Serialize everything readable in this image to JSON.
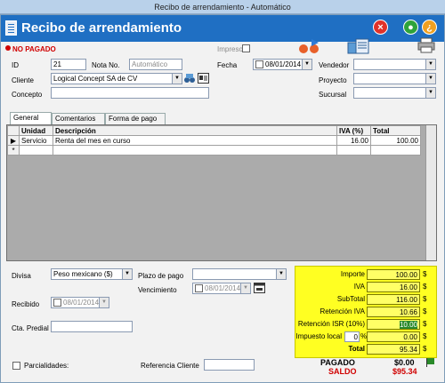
{
  "window": {
    "title": "Recibo de arrendamiento - Automático"
  },
  "header": {
    "title": "Recibo de arrendamiento"
  },
  "status": {
    "label": "NO PAGADO",
    "color": "#d00000"
  },
  "impreso": {
    "label": "Impreso"
  },
  "fields": {
    "id": {
      "label": "ID",
      "value": "21"
    },
    "nota": {
      "label": "Nota No.",
      "value": "Automático"
    },
    "fecha": {
      "label": "Fecha",
      "value": "08/01/2014"
    },
    "cliente": {
      "label": "Cliente",
      "value": "Logical Concept SA de CV"
    },
    "concepto": {
      "label": "Concepto",
      "value": ""
    },
    "vendedor": {
      "label": "Vendedor",
      "value": ""
    },
    "proyecto": {
      "label": "Proyecto",
      "value": ""
    },
    "sucursal": {
      "label": "Sucursal",
      "value": ""
    }
  },
  "tabs": [
    {
      "label": "General"
    },
    {
      "label": "Comentarios"
    },
    {
      "label": "Forma de pago"
    }
  ],
  "grid": {
    "columns": [
      "Unidad",
      "Descripción",
      "IVA (%)",
      "Total"
    ],
    "rows": [
      {
        "unidad": "Servicio",
        "descripcion": "Renta del mes en curso",
        "iva": "16.00",
        "total": "100.00"
      }
    ],
    "new_row_marker": "*",
    "current_row_marker": "▶"
  },
  "bottom": {
    "divisa": {
      "label": "Divisa",
      "value": "Peso mexicano ($)"
    },
    "plazo": {
      "label": "Plazo de pago",
      "value": ""
    },
    "vencimiento": {
      "label": "Vencimiento",
      "value": "08/01/2014"
    },
    "recibido": {
      "label": "Recibido",
      "value": "08/01/2014"
    },
    "predial": {
      "label": "Cta. Predial",
      "value": ""
    },
    "parcialidades": {
      "label": "Parcialidades:"
    },
    "referencia": {
      "label": "Referencia Cliente",
      "value": ""
    }
  },
  "totals": {
    "importe": {
      "label": "Importe",
      "value": "100.00",
      "currency": "$"
    },
    "iva": {
      "label": "IVA",
      "value": "16.00",
      "currency": "$"
    },
    "subtotal": {
      "label": "SubTotal",
      "value": "116.00",
      "currency": "$"
    },
    "ret_iva": {
      "label": "Retención IVA",
      "value": "10.66",
      "currency": "$"
    },
    "ret_isr": {
      "label": "Retención ISR (10%)",
      "value": "10.00",
      "currency": "$"
    },
    "impuesto_local": {
      "label": "Impuesto local",
      "percent": "0",
      "percent_sign": "%",
      "value": "0.00",
      "currency": "$"
    },
    "total": {
      "label": "Total",
      "value": "95.34",
      "currency": "$"
    }
  },
  "payment": {
    "pagado_label": "PAGADO",
    "pagado_value": "$0.00",
    "saldo_label": "SALDO",
    "saldo_value": "$95.34"
  },
  "colors": {
    "header": "#1f6fc3",
    "totals_bg": "#ffff22",
    "saldo": "#d00000"
  }
}
